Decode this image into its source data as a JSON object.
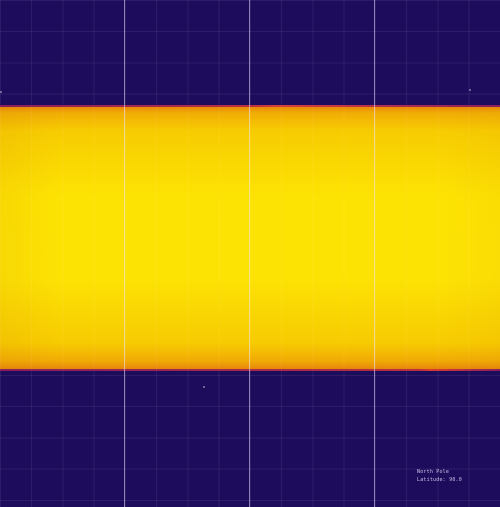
{
  "readout": {
    "location": "North Pole",
    "latitude_label": "Latitude:",
    "latitude_value": "90.0"
  },
  "colors": {
    "background": "#1d0c5c",
    "band_core": "#fde303",
    "band_edge": "#e88a0a",
    "meridian_line": "#ebe1ff"
  }
}
